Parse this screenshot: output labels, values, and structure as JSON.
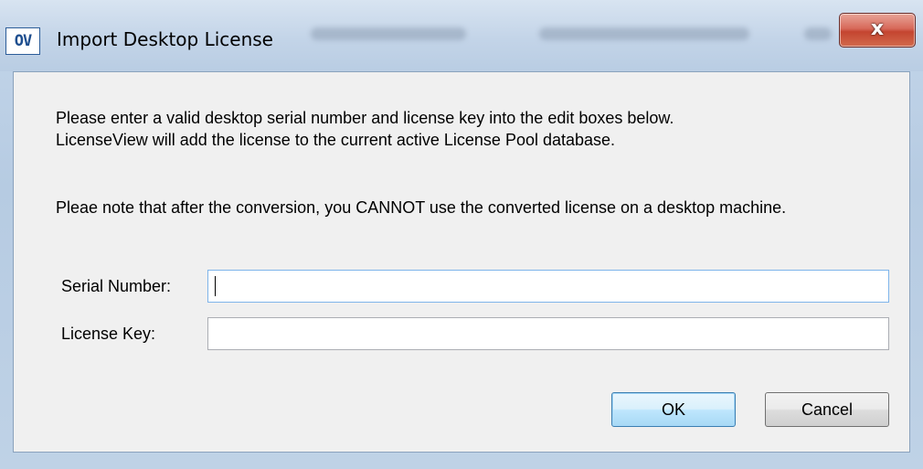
{
  "window": {
    "title": "Import Desktop License",
    "icon_text": "OV",
    "close_glyph": "x"
  },
  "content": {
    "paragraph1_line1": "Please enter a valid desktop serial number and license key into the edit boxes below.",
    "paragraph1_line2": "LicenseView will add the license to the current active License Pool database.",
    "paragraph2": "Pleae note that after the conversion, you CANNOT use the converted license on a desktop machine."
  },
  "form": {
    "serial_label": "Serial Number:",
    "serial_value": "",
    "key_label": "License Key:",
    "key_value": ""
  },
  "buttons": {
    "ok_label": "OK",
    "cancel_label": "Cancel"
  },
  "colors": {
    "close_button": "#c44530",
    "focus_border": "#7eb4ea",
    "default_button": "#3c7fb1"
  }
}
